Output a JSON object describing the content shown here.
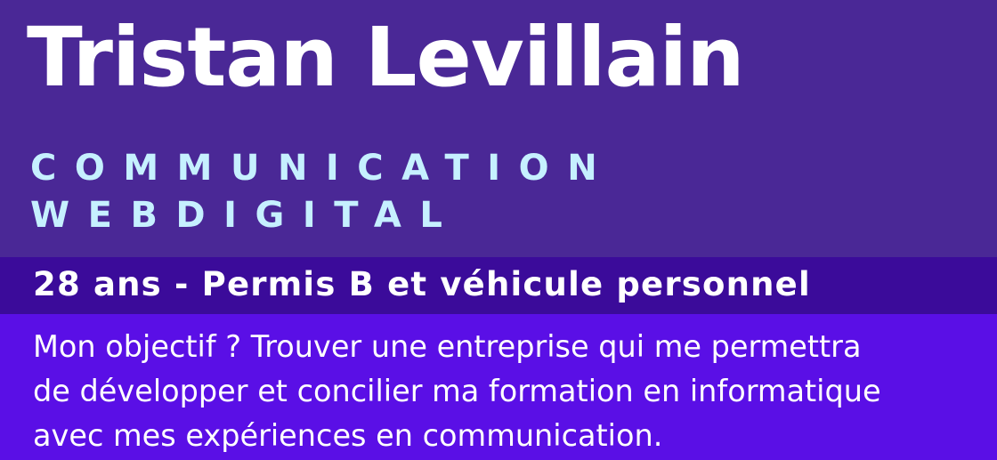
{
  "header": {
    "name": "Tristan Levillain",
    "role_line_1": "COMMUNICATION",
    "role_line_2": "WEBDIGITAL"
  },
  "details": {
    "text": "28 ans - Permis B et véhicule personnel"
  },
  "objective": {
    "lines": [
      "Mon objectif ? Trouver une entreprise qui me permettra",
      "de développer et concilier ma formation en informatique",
      "avec mes expériences en communication."
    ]
  },
  "colors": {
    "hero_background": "#4a2896",
    "details_background": "#3b0b9a",
    "objective_background": "#5a0fe6",
    "accent_text": "#c6f0ff",
    "main_text": "#ffffff"
  }
}
